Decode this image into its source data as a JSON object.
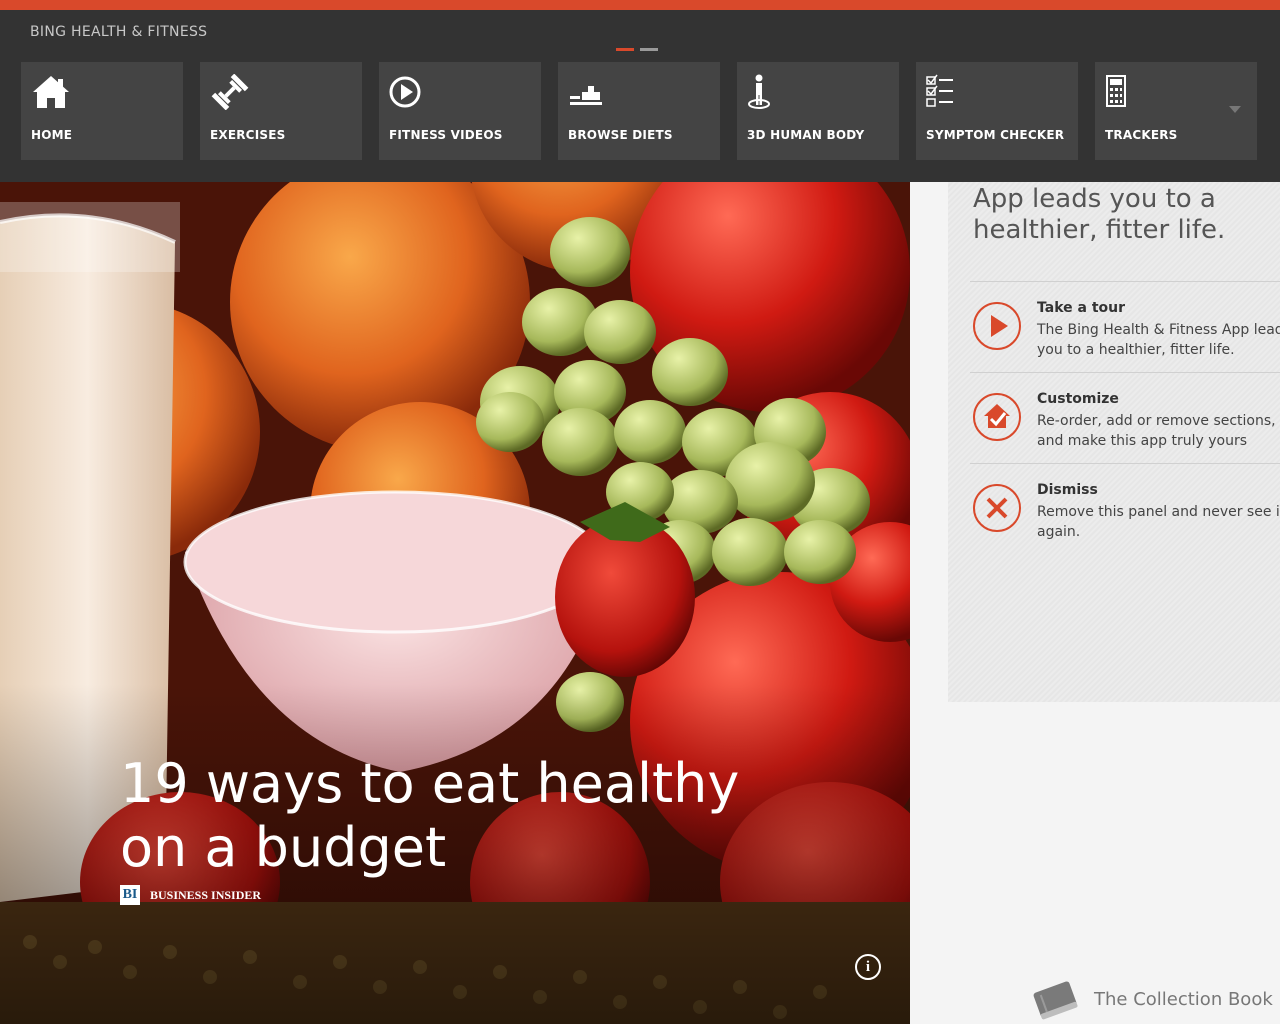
{
  "app": {
    "title": "BING HEALTH & FITNESS",
    "accent_color": "#d9492b"
  },
  "nav": {
    "items": [
      {
        "label": "HOME",
        "icon": "home-icon"
      },
      {
        "label": "EXERCISES",
        "icon": "dumbbell-icon"
      },
      {
        "label": "FITNESS VIDEOS",
        "icon": "play-circle-icon"
      },
      {
        "label": "BROWSE DIETS",
        "icon": "food-tray-icon"
      },
      {
        "label": "3D HUMAN BODY",
        "icon": "human-body-icon"
      },
      {
        "label": "SYMPTOM CHECKER",
        "icon": "checklist-icon"
      },
      {
        "label": "TRACKERS",
        "icon": "calculator-icon"
      }
    ],
    "more_icon": "chevron-down-icon"
  },
  "hero": {
    "title": "19 ways to eat healthy on a budget",
    "source": "BUSINESS INSIDER",
    "source_logo": "BI",
    "info_glyph": "i"
  },
  "panel": {
    "intro": "App leads you to a healthier, fitter life.",
    "actions": [
      {
        "title": "Take a tour",
        "desc": "The Bing Health & Fitness App leads you to a healthier, fitter life.",
        "icon": "play-icon"
      },
      {
        "title": "Customize",
        "desc": "Re-order, add or remove sections, and make this app truly yours",
        "icon": "house-check-icon"
      },
      {
        "title": "Dismiss",
        "desc": "Remove this panel and never see it again.",
        "icon": "close-icon"
      }
    ]
  },
  "watermark": {
    "text": "The Collection Book",
    "icon": "book-icon"
  }
}
